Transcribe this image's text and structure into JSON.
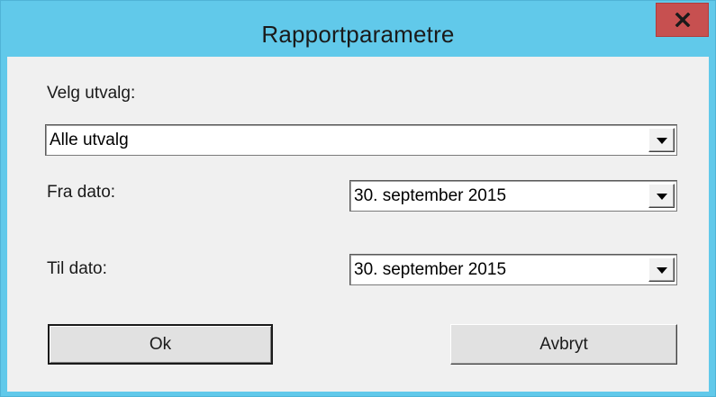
{
  "window": {
    "title": "Rapportparametre",
    "accent_color": "#61c9ea",
    "close_color": "#c75050"
  },
  "selection": {
    "label": "Velg utvalg:",
    "value": "Alle utvalg"
  },
  "from_date": {
    "label": "Fra dato:",
    "value": "30. september 2015"
  },
  "to_date": {
    "label": "Til dato:",
    "value": "30. september 2015"
  },
  "buttons": {
    "ok": "Ok",
    "cancel": "Avbryt"
  },
  "icons": {
    "close": "close-icon",
    "dropdown": "chevron-down-icon"
  }
}
